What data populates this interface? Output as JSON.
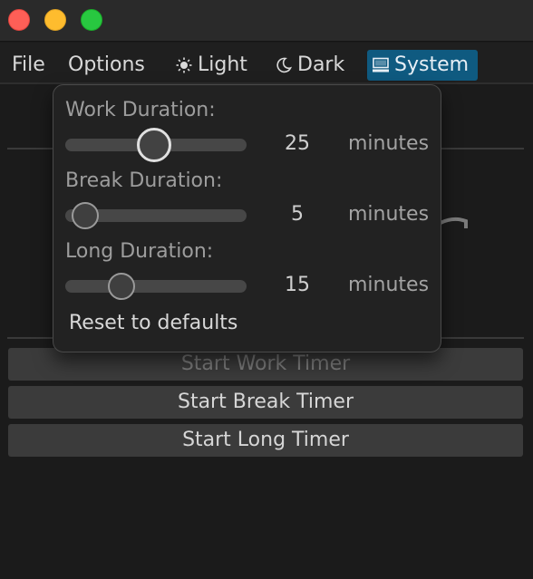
{
  "menubar": {
    "file": "File",
    "options": "Options",
    "light": "Light",
    "dark": "Dark",
    "system": "System"
  },
  "settings": {
    "work": {
      "label": "Work Duration:",
      "value": "25",
      "unit": "minutes",
      "fraction": 0.45
    },
    "break": {
      "label": "Break Duration:",
      "value": "5",
      "unit": "minutes",
      "fraction": 0.07
    },
    "long": {
      "label": "Long Duration:",
      "value": "15",
      "unit": "minutes",
      "fraction": 0.27
    },
    "reset": "Reset to defaults"
  },
  "buttons": {
    "work": "Start Work Timer",
    "break": "Start Break Timer",
    "long": "Start Long Timer"
  },
  "colors": {
    "accent": "#0f5a80",
    "close": "#fe5f57",
    "minimize": "#febc2e",
    "maximize": "#28c840"
  }
}
